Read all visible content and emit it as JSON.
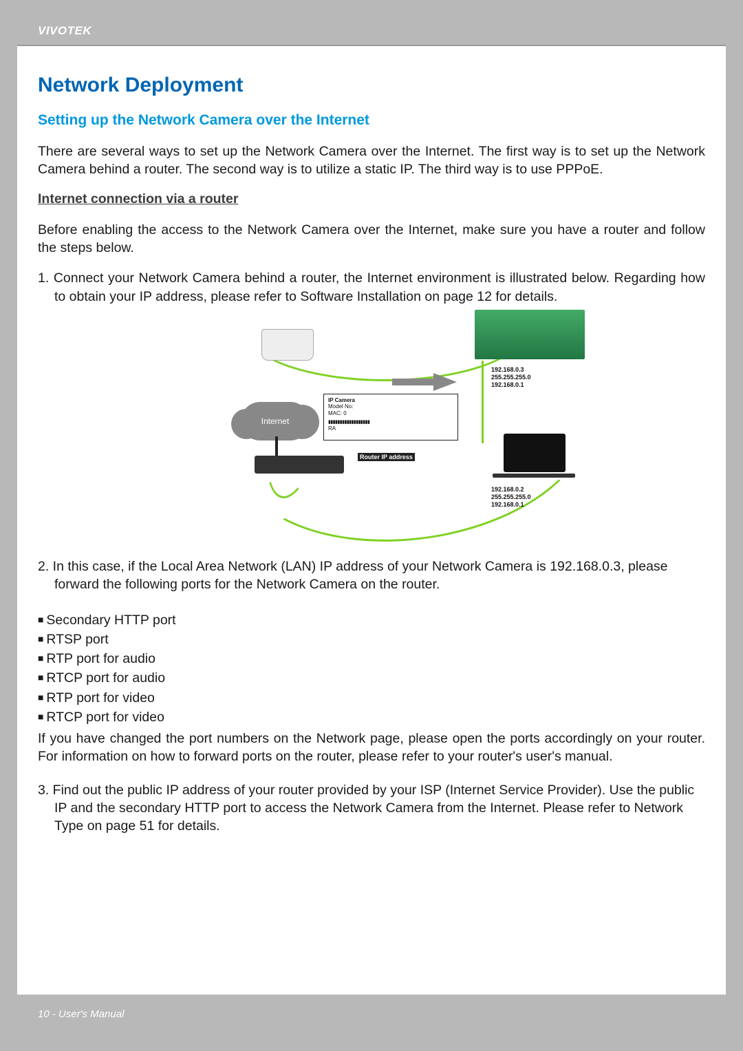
{
  "header": {
    "brand": "VIVOTEK"
  },
  "section": {
    "title": "Network Deployment",
    "subtitle": "Setting up the Network Camera over the Internet",
    "intro": "There are several ways to set up the Network Camera over the Internet. The first way is to set up the Network Camera behind a router. The second way is to utilize a static IP. The third way is to use PPPoE.",
    "sub_heading": "Internet connection via a router",
    "before_text": "Before enabling the access to the Network Camera over the Internet, make sure you have a router and follow the steps below.",
    "step1": "1. Connect your Network Camera behind a router, the Internet environment is illustrated below. Regarding how to obtain your IP address, please refer to Software Installation on page 12 for details.",
    "step2": "2. In this case, if the Local Area Network (LAN) IP address of your Network Camera is 192.168.0.3, please forward the following ports for the Network Camera on the router.",
    "ports": [
      "Secondary HTTP port",
      "RTSP port",
      "RTP port for audio",
      "RTCP port for audio",
      "RTP port for video",
      "RTCP port for video"
    ],
    "after_ports": "If you have changed the port numbers on the Network page, please open the ports accordingly on your router. For information on how to forward ports on the router, please refer to your router's user's manual.",
    "step3": "3. Find out the public IP address of your router provided by your ISP (Internet Service Provider). Use the public IP and the secondary HTTP port to access the Network Camera from the Internet. Please refer to Network Type on page 51 for details."
  },
  "diagram": {
    "cloud_label": "Internet",
    "label_line1": "IP Camera",
    "label_line2": "Model No:",
    "label_line3": "MAC: 0",
    "label_line4": "RA",
    "router_label": "Router IP address",
    "device1_line1": "192.168.0.3",
    "device1_line2": "255.255.255.0",
    "device1_line3": "192.168.0.1",
    "device2_line1": "192.168.0.2",
    "device2_line2": "255.255.255.0",
    "device2_line3": "192.168.0.1"
  },
  "footer": {
    "text": "10 - User's Manual"
  }
}
